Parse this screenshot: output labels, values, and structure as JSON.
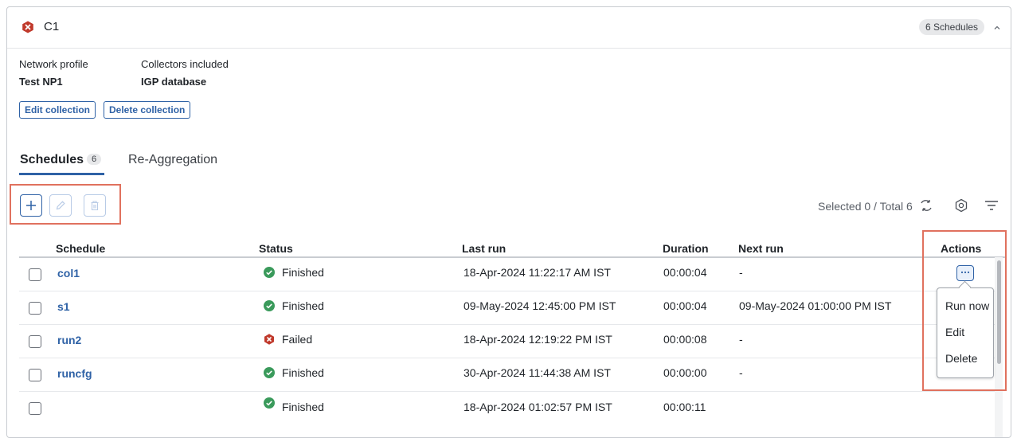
{
  "card": {
    "title": "C1",
    "schedule_count_badge": "6 Schedules",
    "collapse_icon": "chevron-up-icon",
    "status_color": "#c0392b"
  },
  "info": {
    "network_profile_label": "Network profile",
    "network_profile_value": "Test NP1",
    "collectors_label": "Collectors included",
    "collectors_value": "IGP database"
  },
  "buttons": {
    "edit_collection": "Edit collection",
    "delete_collection": "Delete collection"
  },
  "tabs": [
    {
      "label": "Schedules",
      "count": "6",
      "active": true
    },
    {
      "label": "Re-Aggregation",
      "active": false
    }
  ],
  "toolbar": {
    "add_icon": "plus-icon",
    "edit_icon": "pencil-icon",
    "delete_icon": "trash-icon",
    "selected_text": "Selected 0 / Total 6",
    "refresh_icon": "refresh-icon",
    "settings_icon": "gear-icon",
    "filter_icon": "filter-icon"
  },
  "table": {
    "columns": [
      "Schedule",
      "Status",
      "Last run",
      "Duration",
      "Next run",
      "Actions"
    ],
    "rows": [
      {
        "schedule": "col1",
        "status": "Finished",
        "last_run": "18-Apr-2024 11:22:17 AM IST",
        "duration": "00:00:04",
        "next_run": "-"
      },
      {
        "schedule": "s1",
        "status": "Finished",
        "last_run": "09-May-2024 12:45:00 PM IST",
        "duration": "00:00:04",
        "next_run": "09-May-2024 01:00:00 PM IST"
      },
      {
        "schedule": "run2",
        "status": "Failed",
        "last_run": "18-Apr-2024 12:19:22 PM IST",
        "duration": "00:00:08",
        "next_run": "-"
      },
      {
        "schedule": "runcfg",
        "status": "Finished",
        "last_run": "30-Apr-2024 11:44:38 AM IST",
        "duration": "00:00:00",
        "next_run": "-"
      },
      {
        "schedule": "",
        "status": "Finished",
        "last_run": "18-Apr-2024 01:02:57 PM IST",
        "duration": "00:00:11",
        "next_run": ""
      }
    ]
  },
  "actions_menu": {
    "kebab_icon": "more-horizontal-icon",
    "items": [
      "Run now",
      "Edit",
      "Delete"
    ]
  },
  "colors": {
    "accent": "#2f62a6",
    "success": "#3a9a5b",
    "error": "#c0392b",
    "highlight_box": "#e0715e"
  }
}
